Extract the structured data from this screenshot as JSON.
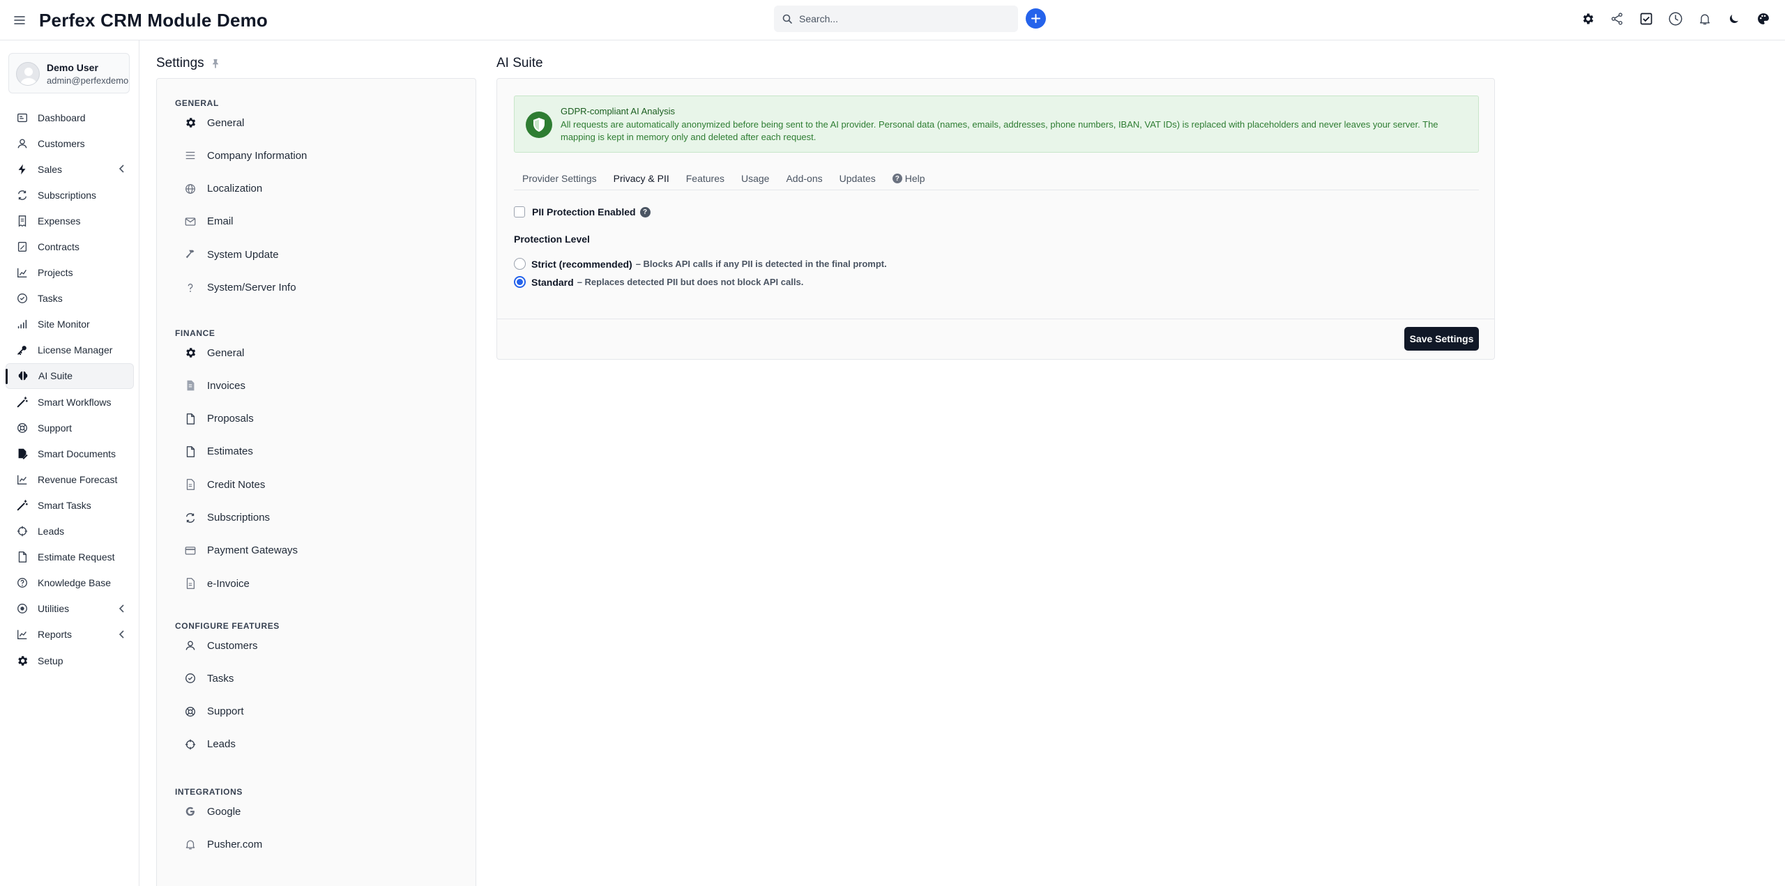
{
  "app": {
    "title": "Perfex CRM Module Demo"
  },
  "search": {
    "placeholder": "Search..."
  },
  "header_icons": [
    "gear-icon",
    "share-icon",
    "task-check-icon",
    "clock-icon",
    "bell-icon",
    "moon-icon",
    "palette-icon"
  ],
  "user": {
    "name": "Demo User",
    "email": "admin@perfexdemo.c..."
  },
  "sidebar": {
    "items": [
      {
        "label": "Dashboard",
        "icon": "dashboard-icon"
      },
      {
        "label": "Customers",
        "icon": "user-icon"
      },
      {
        "label": "Sales",
        "icon": "bolt-icon",
        "has_submenu": true
      },
      {
        "label": "Subscriptions",
        "icon": "refresh-icon"
      },
      {
        "label": "Expenses",
        "icon": "receipt-icon"
      },
      {
        "label": "Contracts",
        "icon": "contract-icon"
      },
      {
        "label": "Projects",
        "icon": "chart-bar-icon"
      },
      {
        "label": "Tasks",
        "icon": "check-circle-icon"
      },
      {
        "label": "Site Monitor",
        "icon": "signal-icon"
      },
      {
        "label": "License Manager",
        "icon": "key-icon"
      },
      {
        "label": "AI Suite",
        "icon": "brain-icon",
        "active": true
      },
      {
        "label": "Smart Workflows",
        "icon": "wand-icon"
      },
      {
        "label": "Support",
        "icon": "lifebuoy-icon"
      },
      {
        "label": "Smart Documents",
        "icon": "doc-edit-icon"
      },
      {
        "label": "Revenue Forecast",
        "icon": "trend-icon"
      },
      {
        "label": "Smart Tasks",
        "icon": "wand-icon"
      },
      {
        "label": "Leads",
        "icon": "crosshair-icon"
      },
      {
        "label": "Estimate Request",
        "icon": "file-icon"
      },
      {
        "label": "Knowledge Base",
        "icon": "question-circle-icon"
      },
      {
        "label": "Utilities",
        "icon": "record-icon",
        "has_submenu": true
      },
      {
        "label": "Reports",
        "icon": "trend-icon",
        "has_submenu": true
      },
      {
        "label": "Setup",
        "icon": "gear-icon"
      }
    ]
  },
  "settings": {
    "title": "Settings",
    "groups": [
      {
        "title": "GENERAL",
        "items": [
          {
            "label": "General",
            "icon": "gear-icon"
          },
          {
            "label": "Company Information",
            "icon": "lines-icon"
          },
          {
            "label": "Localization",
            "icon": "globe-icon"
          },
          {
            "label": "Email",
            "icon": "mail-icon"
          },
          {
            "label": "System Update",
            "icon": "hammer-icon"
          },
          {
            "label": "System/Server Info",
            "icon": "question-icon"
          }
        ]
      },
      {
        "title": "FINANCE",
        "items": [
          {
            "label": "General",
            "icon": "gear-icon"
          },
          {
            "label": "Invoices",
            "icon": "invoice-icon"
          },
          {
            "label": "Proposals",
            "icon": "file-icon"
          },
          {
            "label": "Estimates",
            "icon": "file-icon"
          },
          {
            "label": "Credit Notes",
            "icon": "doc-lines-icon"
          },
          {
            "label": "Subscriptions",
            "icon": "refresh-icon"
          },
          {
            "label": "Payment Gateways",
            "icon": "credit-card-icon"
          },
          {
            "label": "e-Invoice",
            "icon": "doc-lines-icon"
          }
        ]
      },
      {
        "title": "CONFIGURE FEATURES",
        "items": [
          {
            "label": "Customers",
            "icon": "user-icon"
          },
          {
            "label": "Tasks",
            "icon": "check-circle-icon"
          },
          {
            "label": "Support",
            "icon": "lifebuoy-icon"
          },
          {
            "label": "Leads",
            "icon": "crosshair-icon"
          }
        ]
      },
      {
        "title": "INTEGRATIONS",
        "items": [
          {
            "label": "Google",
            "icon": "google-icon"
          },
          {
            "label": "Pusher.com",
            "icon": "bell-icon"
          }
        ]
      }
    ]
  },
  "main": {
    "title": "AI Suite",
    "alert": {
      "title": "GDPR-compliant AI Analysis",
      "text": "All requests are automatically anonymized before being sent to the AI provider. Personal data (names, emails, addresses, phone numbers, IBAN, VAT IDs) is replaced with placeholders and never leaves your server. The mapping is kept in memory only and deleted after each request."
    },
    "tabs": [
      {
        "label": "Provider Settings"
      },
      {
        "label": "Privacy & PII",
        "active": true
      },
      {
        "label": "Features"
      },
      {
        "label": "Usage"
      },
      {
        "label": "Add-ons"
      },
      {
        "label": "Updates"
      },
      {
        "label": "Help",
        "icon": "help-icon"
      }
    ],
    "pii_checkbox": {
      "label": "PII Protection Enabled",
      "checked": false
    },
    "protection_level": {
      "label": "Protection Level",
      "options": [
        {
          "label": "Strict (recommended)",
          "desc": "– Blocks API calls if any PII is detected in the final prompt.",
          "checked": false
        },
        {
          "label": "Standard",
          "desc": "– Replaces detected PII but does not block API calls.",
          "checked": true
        }
      ]
    },
    "save_label": "Save Settings"
  },
  "colors": {
    "accent": "#2563eb",
    "alert_bg": "#e8f5e9",
    "alert_icon": "#2e7d32",
    "button": "#111827"
  }
}
